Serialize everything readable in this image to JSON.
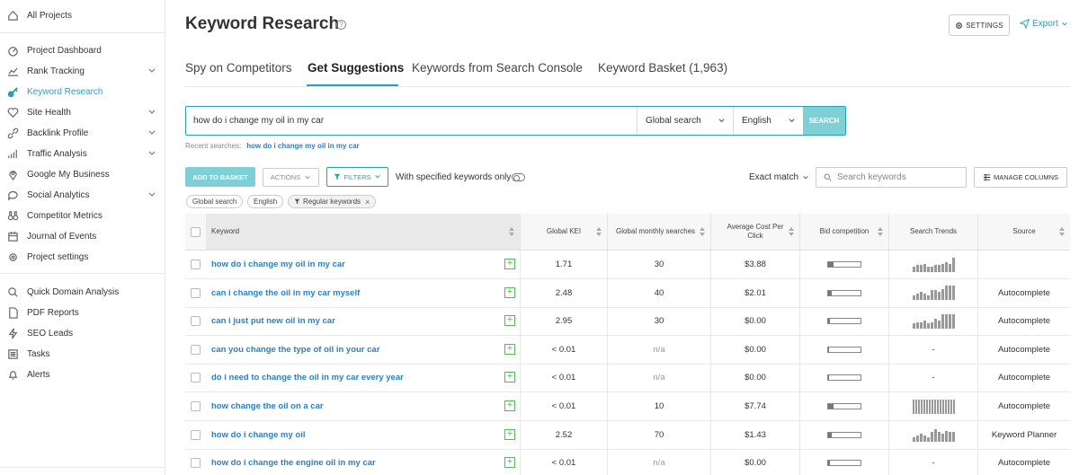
{
  "sidebar": {
    "items": [
      {
        "label": "All Projects",
        "icon": "home-icon"
      },
      {
        "label": "Project Dashboard",
        "icon": "dashboard-icon"
      },
      {
        "label": "Rank Tracking",
        "icon": "chart-line-icon",
        "expandable": true
      },
      {
        "label": "Keyword Research",
        "icon": "key-icon",
        "active": true
      },
      {
        "label": "Site Health",
        "icon": "heart-pulse-icon",
        "expandable": true
      },
      {
        "label": "Backlink Profile",
        "icon": "link-icon",
        "expandable": true
      },
      {
        "label": "Traffic Analysis",
        "icon": "bar-chart-icon",
        "expandable": true
      },
      {
        "label": "Google My Business",
        "icon": "map-pin-icon"
      },
      {
        "label": "Social Analytics",
        "icon": "chat-bubble-icon",
        "expandable": true
      },
      {
        "label": "Competitor Metrics",
        "icon": "binoculars-icon"
      },
      {
        "label": "Journal of Events",
        "icon": "calendar-icon"
      },
      {
        "label": "Project settings",
        "icon": "gear-icon"
      },
      {
        "label": "Quick Domain Analysis",
        "icon": "search-link-icon"
      },
      {
        "label": "PDF Reports",
        "icon": "pdf-icon"
      },
      {
        "label": "SEO Leads",
        "icon": "lightning-icon"
      },
      {
        "label": "Tasks",
        "icon": "tasks-icon"
      },
      {
        "label": "Alerts",
        "icon": "bell-icon"
      }
    ]
  },
  "header": {
    "title": "Keyword Research",
    "help": "?",
    "settings_label": "SETTINGS",
    "export_label": "Export"
  },
  "tabs": [
    {
      "label": "Spy on Competitors"
    },
    {
      "label": "Get Suggestions",
      "active": true
    },
    {
      "label": "Keywords from Search Console"
    },
    {
      "label": "Keyword Basket (1,963)"
    }
  ],
  "search": {
    "query": "how do i change my oil in my car",
    "scope": "Global search",
    "language": "English",
    "button": "SEARCH",
    "recent_label": "Recent searches:",
    "recent_item": "how do i change my oil in my car"
  },
  "toolbar": {
    "add_basket": "ADD TO BASKET",
    "actions": "ACTIONS",
    "filters": "FILTERS",
    "specified_only": "With specified keywords only",
    "match_mode": "Exact match",
    "search_placeholder": "Search keywords",
    "manage_columns": "MANAGE COLUMNS"
  },
  "chips": [
    "Global search",
    "English",
    "Regular keywords"
  ],
  "table": {
    "columns": {
      "keyword": "Keyword",
      "kei": "Global KEI",
      "gms": "Global monthly searches",
      "cpc": "Average Cost Per Click",
      "bid": "Bid competition",
      "trends": "Search Trends",
      "source": "Source"
    },
    "rows": [
      {
        "keyword": "how do i change my oil in my car",
        "kei": "1.71",
        "gms": "30",
        "cpc": "$3.88",
        "bid": 0.18,
        "trend": [
          3,
          4,
          4,
          5,
          3,
          3,
          4,
          4,
          5,
          6,
          5,
          9
        ],
        "source": ""
      },
      {
        "keyword": "can i change the oil in my car myself",
        "kei": "2.48",
        "gms": "40",
        "cpc": "$2.01",
        "bid": 0.12,
        "trend": [
          3,
          4,
          5,
          4,
          3,
          6,
          6,
          5,
          7,
          9,
          9,
          9
        ],
        "source": "Autocomplete"
      },
      {
        "keyword": "can i just put new oil in my car",
        "kei": "2.95",
        "gms": "30",
        "cpc": "$0.00",
        "bid": 0.06,
        "trend": [
          3,
          4,
          4,
          5,
          3,
          4,
          6,
          5,
          9,
          9,
          9,
          9
        ],
        "source": "Autocomplete"
      },
      {
        "keyword": "can you change the type of oil in your car",
        "kei": "< 0.01",
        "gms": "n/a",
        "cpc": "$0.00",
        "bid": 0.02,
        "trend": [],
        "source": "Autocomplete",
        "gms_muted": true
      },
      {
        "keyword": "do i need to change the oil in my car every year",
        "kei": "< 0.01",
        "gms": "n/a",
        "cpc": "$0.00",
        "bid": 0.02,
        "trend": [],
        "source": "Autocomplete",
        "gms_muted": true
      },
      {
        "keyword": "how change the oil on a car",
        "kei": "< 0.01",
        "gms": "10",
        "cpc": "$7.74",
        "bid": 0.18,
        "trend": [
          9,
          9,
          9,
          9,
          9,
          9,
          9,
          9,
          9,
          9,
          9,
          9,
          9,
          9,
          9,
          9
        ],
        "source": "Autocomplete"
      },
      {
        "keyword": "how do i change my oil",
        "kei": "2.52",
        "gms": "70",
        "cpc": "$1.43",
        "bid": 0.12,
        "trend": [
          3,
          4,
          5,
          4,
          3,
          6,
          8,
          6,
          5,
          7,
          6,
          6
        ],
        "source": "Keyword Planner"
      },
      {
        "keyword": "how do i change the engine oil in my car",
        "kei": "< 0.01",
        "gms": "n/a",
        "cpc": "$0.00",
        "bid": 0.06,
        "trend": [],
        "source": "Autocomplete",
        "gms_muted": true
      }
    ]
  }
}
